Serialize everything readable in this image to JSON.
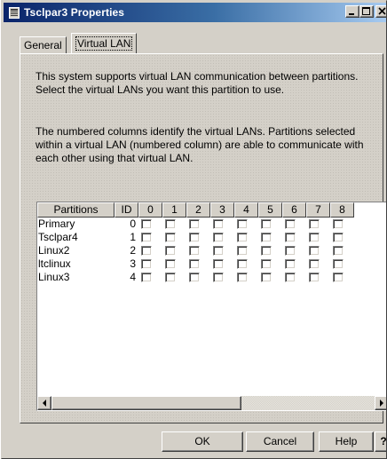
{
  "window": {
    "title": "Tsclpar3 Properties",
    "icon": "properties-window-icon"
  },
  "title_buttons": {
    "minimize_icon": "minimize-icon",
    "maximize_icon": "maximize-icon",
    "close_icon": "close-icon"
  },
  "tabs": [
    {
      "label": "General",
      "selected": false
    },
    {
      "label": "Virtual LAN",
      "selected": true
    }
  ],
  "paragraphs": {
    "intro": "This system supports virtual LAN communication between partitions.  Select the virtual LANs you want this partition to use.",
    "explain": "The numbered columns identify the virtual LANs.  Partitions selected within a virtual LAN (numbered column) are able to communicate with each other using that virtual LAN."
  },
  "table": {
    "headers": [
      "Partitions",
      "ID",
      "0",
      "1",
      "2",
      "3",
      "4",
      "5",
      "6",
      "7",
      "8"
    ],
    "rows": [
      {
        "name": "Primary",
        "id": "0",
        "checked": [
          false,
          false,
          false,
          false,
          false,
          false,
          false,
          false,
          false
        ]
      },
      {
        "name": "Tsclpar4",
        "id": "1",
        "checked": [
          false,
          false,
          false,
          false,
          false,
          false,
          false,
          false,
          false
        ]
      },
      {
        "name": "Linux2",
        "id": "2",
        "checked": [
          false,
          false,
          false,
          false,
          false,
          false,
          false,
          false,
          false
        ]
      },
      {
        "name": "ltclinux",
        "id": "3",
        "checked": [
          false,
          false,
          false,
          false,
          false,
          false,
          false,
          false,
          false
        ]
      },
      {
        "name": "Linux3",
        "id": "4",
        "checked": [
          false,
          false,
          false,
          false,
          false,
          false,
          false,
          false,
          false
        ]
      }
    ]
  },
  "buttons": {
    "ok": "OK",
    "cancel": "Cancel",
    "help": "Help",
    "whats_this": "?"
  },
  "colors": {
    "title_start": "#0a246a",
    "title_end": "#a6caf0",
    "face": "#d4d0c8"
  }
}
